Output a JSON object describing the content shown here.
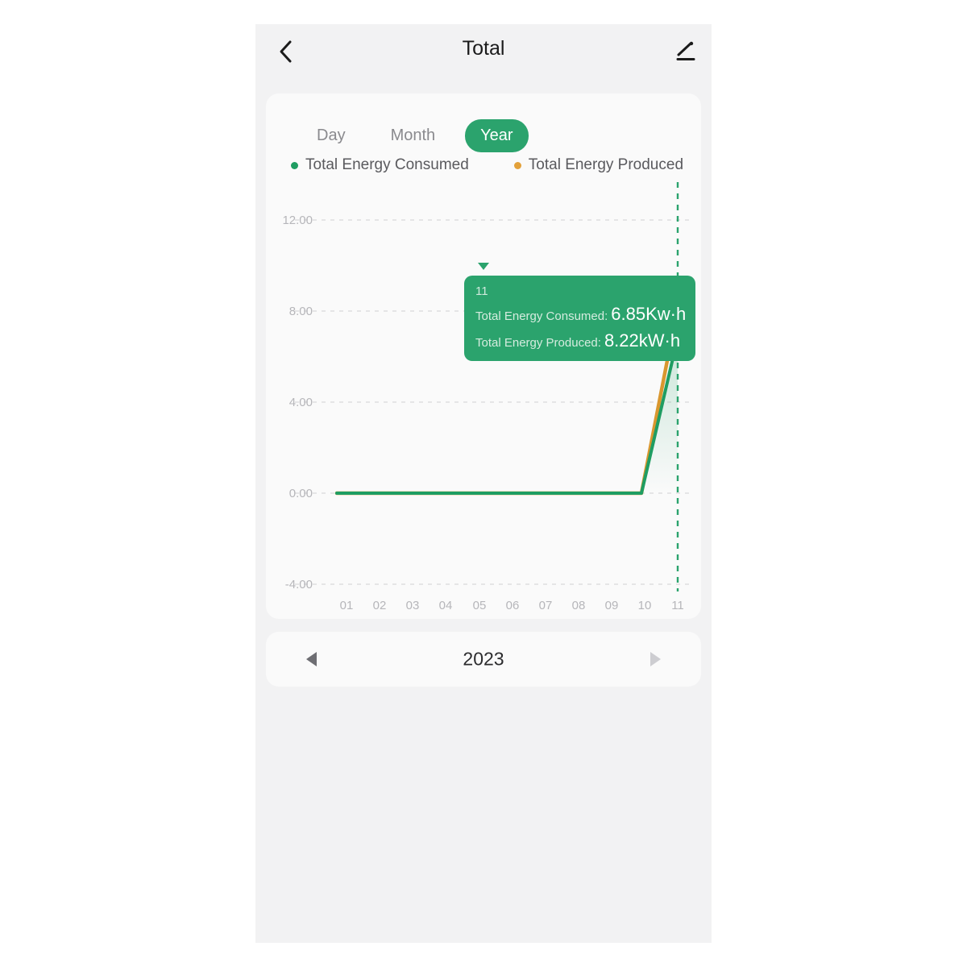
{
  "header": {
    "title": "Total",
    "back_icon": "chevron-left-icon",
    "edit_icon": "pencil-icon"
  },
  "card": {
    "tabs": [
      {
        "label": "Day",
        "active": false
      },
      {
        "label": "Month",
        "active": false
      },
      {
        "label": "Year",
        "active": true
      }
    ],
    "legend": [
      {
        "label": "Total Energy Consumed",
        "color": "#1f9d62"
      },
      {
        "label": "Total Energy Produced",
        "color": "#e3a13a"
      }
    ]
  },
  "tooltip": {
    "x_label": "11",
    "rows": [
      {
        "key": "Total Energy Consumed:",
        "value": "6.85Kw·h"
      },
      {
        "key": "Total Energy Produced:",
        "value": "8.22kW·h"
      }
    ]
  },
  "year_selector": {
    "prev_icon": "triangle-left-icon",
    "next_icon": "triangle-right-icon",
    "year": "2023"
  },
  "colors": {
    "accent_green": "#2ba36d",
    "line_green": "#1f9d62",
    "line_orange": "#e3a13a",
    "page_background": "#f2f2f3",
    "card_background": "#fafafa",
    "grid": "#dedee0",
    "axis_text": "#b6b6ba"
  },
  "chart_data": {
    "type": "line",
    "title": "",
    "xlabel": "",
    "ylabel": "",
    "categories": [
      "01",
      "02",
      "03",
      "04",
      "05",
      "06",
      "07",
      "08",
      "09",
      "10",
      "11"
    ],
    "x_ticks": [
      "01",
      "02",
      "03",
      "04",
      "05",
      "06",
      "07",
      "08",
      "09",
      "10",
      "11"
    ],
    "y_ticks": [
      "12.00",
      "8.00",
      "4.00",
      "0.00",
      "-4.00"
    ],
    "ylim": [
      -4,
      12
    ],
    "grid": true,
    "legend_position": "top-left",
    "highlight_category": "11",
    "series": [
      {
        "name": "Total Energy Consumed",
        "color": "#1f9d62",
        "unit": "Kw·h",
        "values": [
          0,
          0,
          0,
          0,
          0,
          0,
          0,
          0,
          0,
          0,
          6.85
        ]
      },
      {
        "name": "Total Energy Produced",
        "color": "#e3a13a",
        "unit": "kW·h",
        "values": [
          0,
          0,
          0,
          0,
          0,
          0,
          0,
          0,
          0,
          0,
          8.22
        ]
      }
    ]
  }
}
